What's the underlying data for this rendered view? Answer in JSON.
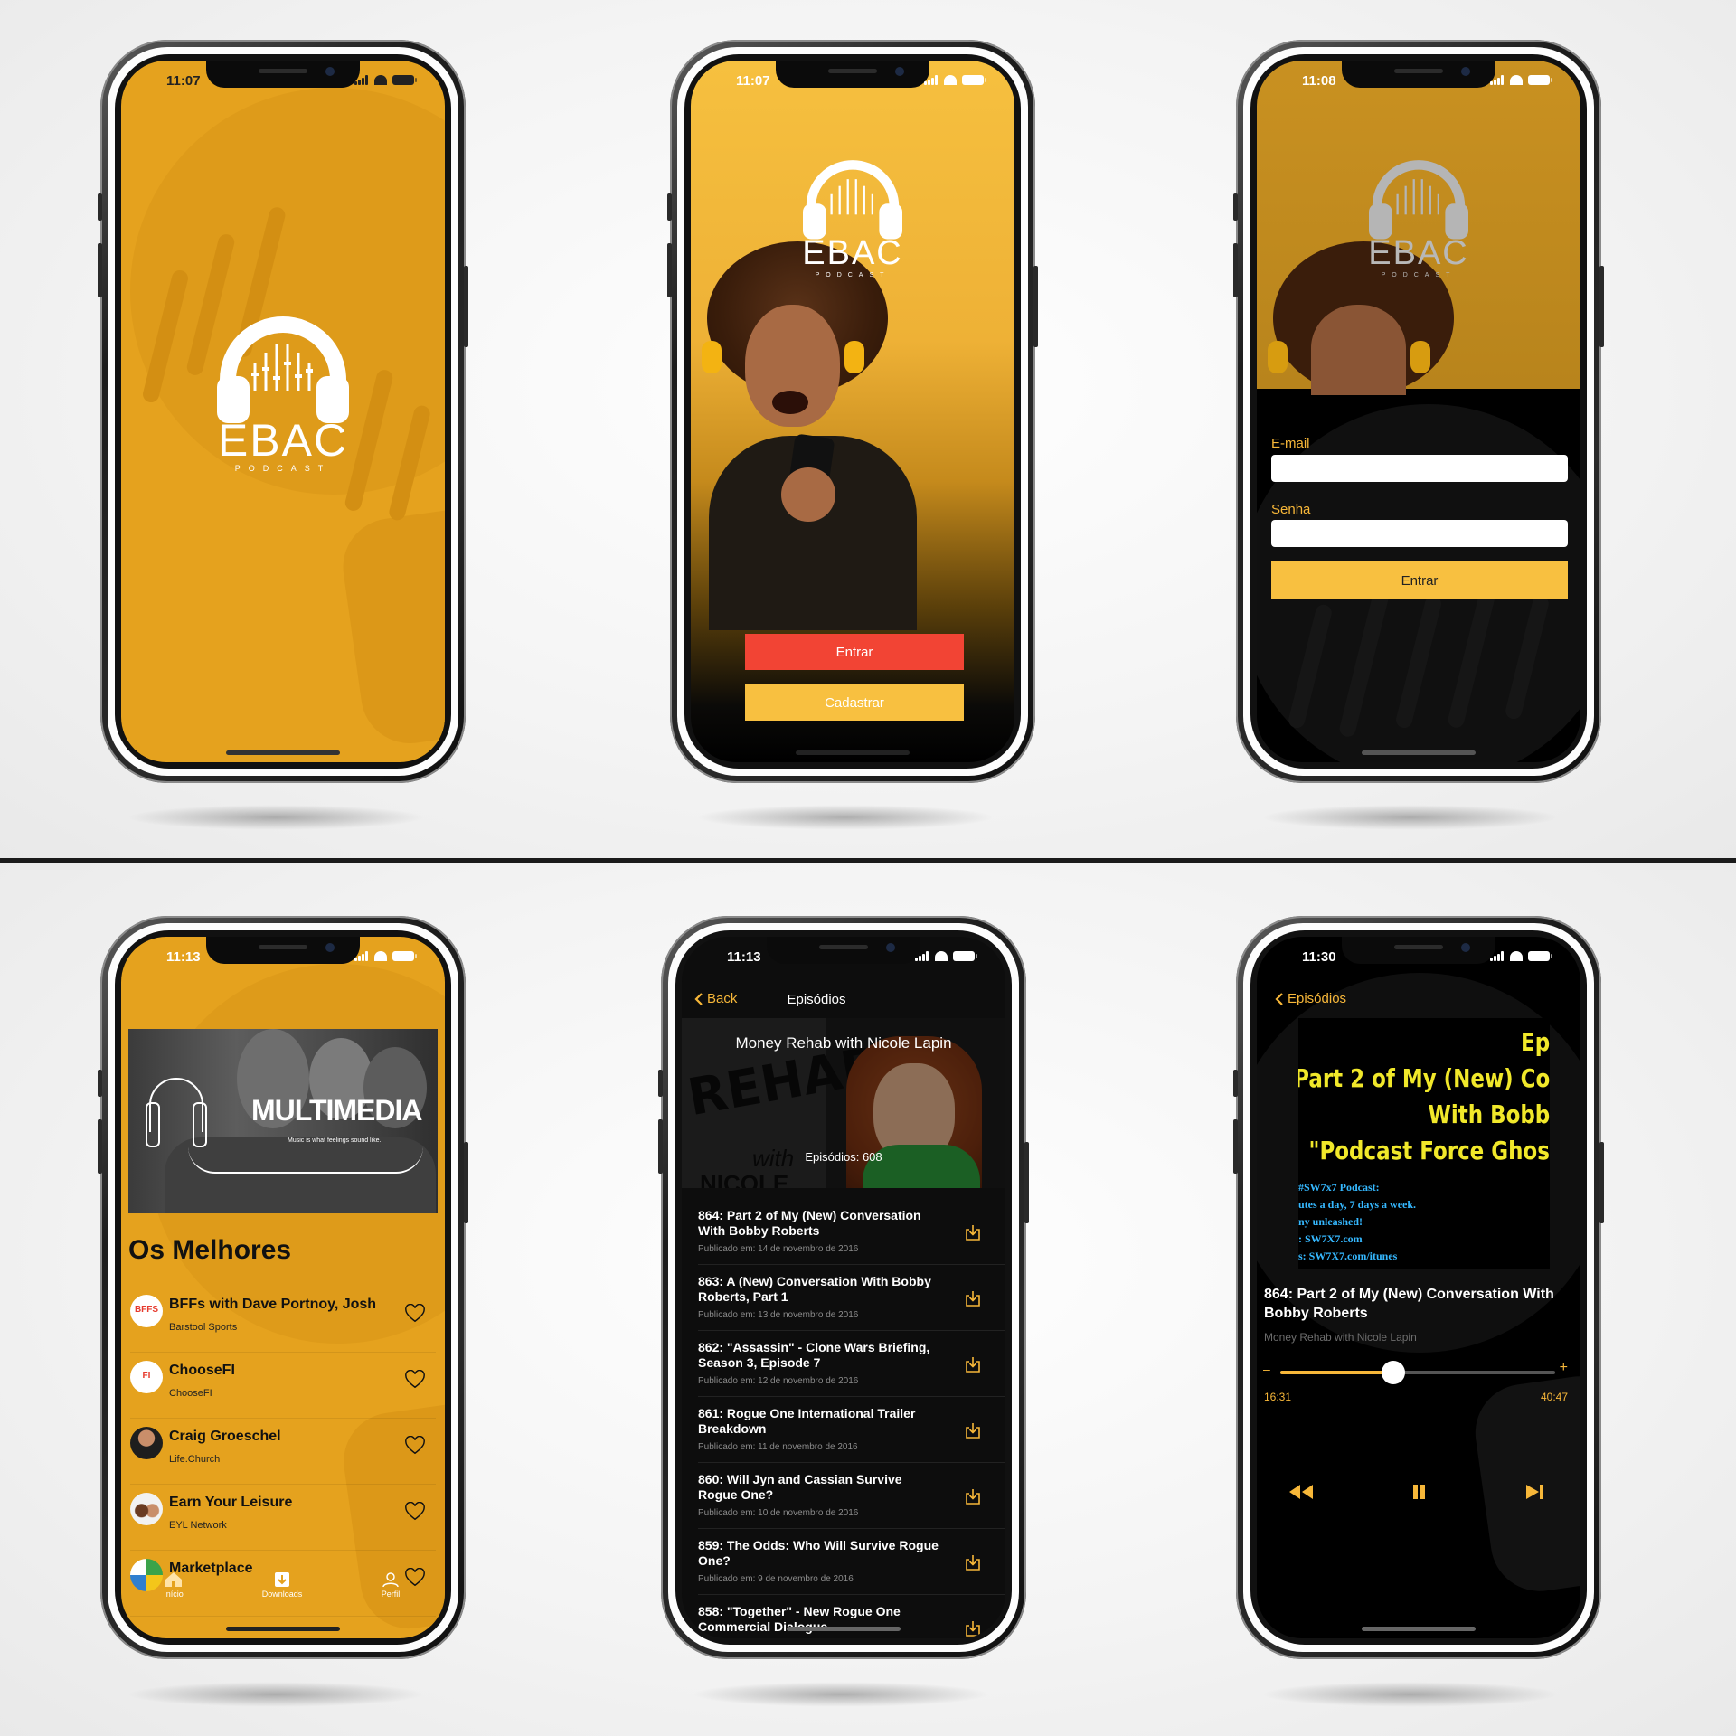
{
  "colors": {
    "amber": "#e5a21e",
    "amber_light": "#f8c040",
    "red_button": "#f24434",
    "yellow_button": "#f8c040",
    "dark": "#000000",
    "accent_text": "#f7b739",
    "art_yellow": "#f1e82a",
    "art_cyan": "#35b8ff"
  },
  "splash": {
    "time": "11:07",
    "logo_word": "EBAC",
    "logo_sub": "PODCAST",
    "logo_icon": "headphones-equalizer-icon"
  },
  "welcome": {
    "time": "11:07",
    "logo_word": "EBAC",
    "logo_sub": "PODCAST",
    "enter_label": "Entrar",
    "register_label": "Cadastrar"
  },
  "login": {
    "time": "11:08",
    "logo_word": "EBAC",
    "logo_sub": "PODCAST",
    "email_label": "E-mail",
    "password_label": "Senha",
    "submit_label": "Entrar"
  },
  "home": {
    "time": "11:13",
    "banner_title": "MULTIMEDIA",
    "banner_tagline": "Music is what feelings sound like.",
    "section_title": "Os Melhores",
    "podcasts": [
      {
        "title": "BFFs with Dave Portnoy, Josh",
        "author": "Barstool Sports",
        "badge": "BFFS"
      },
      {
        "title": "ChooseFI",
        "author": "ChooseFI",
        "badge": "FI"
      },
      {
        "title": "Craig Groeschel",
        "author": "Life.Church",
        "badge": ""
      },
      {
        "title": "Earn Your Leisure",
        "author": "EYL Network",
        "badge": ""
      },
      {
        "title": "Marketplace",
        "author": "",
        "badge": ""
      }
    ],
    "tabs": [
      {
        "label": "Início",
        "icon": "home-icon"
      },
      {
        "label": "Downloads",
        "icon": "download-icon"
      },
      {
        "label": "Perfil",
        "icon": "user-icon"
      }
    ]
  },
  "episodes": {
    "time": "11:13",
    "back_label": "Back",
    "nav_title": "Episódios",
    "podcast_title": "Money Rehab with Nicole Lapin",
    "episode_count": "Episódios: 608",
    "cover_text_1": "REHAB",
    "cover_text_2": "with",
    "cover_text_3": "NICOLE",
    "list": [
      {
        "title": "864: Part 2 of My (New) Conversation With Bobby Roberts",
        "date": "Publicado em: 14 de novembro de 2016"
      },
      {
        "title": "863: A (New) Conversation With Bobby Roberts, Part 1",
        "date": "Publicado em: 13 de novembro de 2016"
      },
      {
        "title": "862: \"Assassin\" - Clone Wars Briefing, Season 3, Episode 7",
        "date": "Publicado em: 12 de novembro de 2016"
      },
      {
        "title": "861: Rogue One International Trailer Breakdown",
        "date": "Publicado em: 11 de novembro de 2016"
      },
      {
        "title": "860: Will Jyn and Cassian Survive Rogue One?",
        "date": "Publicado em: 10 de novembro de 2016"
      },
      {
        "title": "859: The Odds: Who Will Survive Rogue One?",
        "date": "Publicado em: 9 de novembro de 2016"
      },
      {
        "title": "858: \"Together\" - New Rogue One Commercial Dialogue",
        "date": ""
      }
    ]
  },
  "player": {
    "time": "11:30",
    "back_label": "Episódios",
    "art_lines": [
      "Ep",
      "Part 2 of My (New) Co",
      "With Bobb",
      "\"Podcast Force Ghos"
    ],
    "art_small": [
      "#SW7x7 Podcast:",
      "utes a day, 7 days a week.",
      "ny unleashed!",
      ": SW7X7.com",
      "s: SW7X7.com/itunes"
    ],
    "episode_title": "864: Part 2 of My (New) Conversation With Bobby Roberts",
    "podcast_name": "Money Rehab with Nicole Lapin",
    "elapsed": "16:31",
    "duration": "40:47",
    "progress": 0.41,
    "minus_label": "–",
    "plus_label": "+"
  }
}
